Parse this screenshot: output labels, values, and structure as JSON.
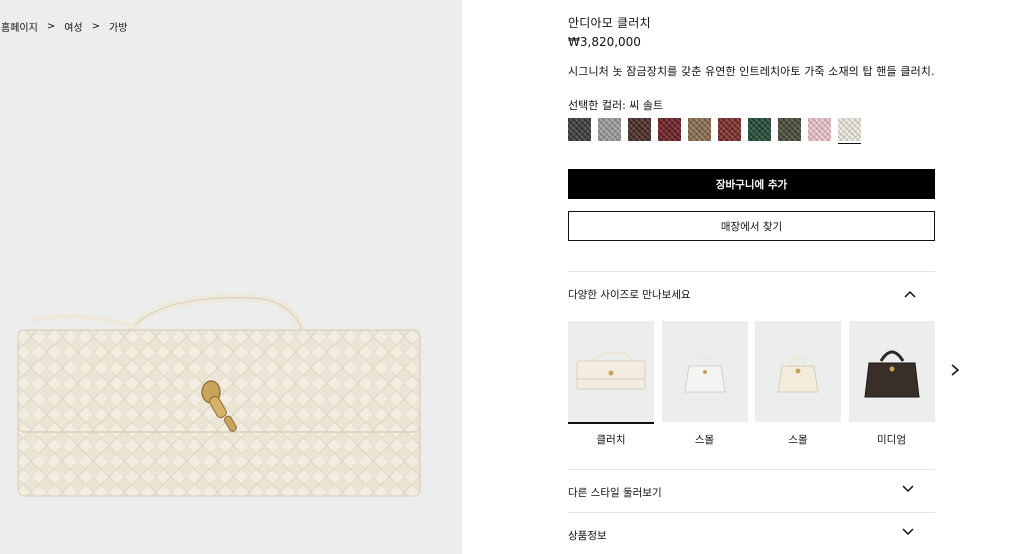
{
  "breadcrumb": {
    "items": [
      "홈페이지",
      "여성",
      "가방"
    ],
    "separator": ">"
  },
  "product": {
    "name": "안디아모 클러치",
    "price": "₩3,820,000",
    "description": "시그니처 놋 잠금장치를 갖춘 유연한 인트레치아토 가죽 소재의 탑 핸들 클러치.",
    "selected_color_label": "선택한 컬러: 씨 솔트"
  },
  "swatches": [
    {
      "color": "#3a3a3a",
      "selected": false
    },
    {
      "color": "#9c9c9c",
      "selected": false
    },
    {
      "color": "#4a2a24",
      "selected": false
    },
    {
      "color": "#6b1c22",
      "selected": false
    },
    {
      "color": "#8a6c4e",
      "selected": false
    },
    {
      "color": "#7a2a26",
      "selected": false
    },
    {
      "color": "#1f4a34",
      "selected": false
    },
    {
      "color": "#4a4a38",
      "selected": false
    },
    {
      "color": "#f0c8cc",
      "selected": false
    },
    {
      "color": "#f1ede2",
      "selected": true
    }
  ],
  "actions": {
    "add_to_cart": "장바구니에 추가",
    "find_in_store": "매장에서 찾기"
  },
  "sections": {
    "sizes_title": "다양한 사이즈로 만나보세요",
    "more_styles_title": "다른 스타일 둘러보기",
    "product_info_title": "상품정보"
  },
  "sizes": [
    {
      "label": "클러치",
      "active": true,
      "icon": "clutch-thumbnail"
    },
    {
      "label": "스몰",
      "active": false,
      "icon": "small-white-bag-thumbnail"
    },
    {
      "label": "스몰",
      "active": false,
      "icon": "small-cream-bag-thumbnail"
    },
    {
      "label": "미디엄",
      "active": false,
      "icon": "medium-dark-bag-thumbnail"
    }
  ],
  "icons": {
    "chevron_up": "chevron-up-icon",
    "chevron_down": "chevron-down-icon",
    "carousel_next": "chevron-right-icon"
  }
}
